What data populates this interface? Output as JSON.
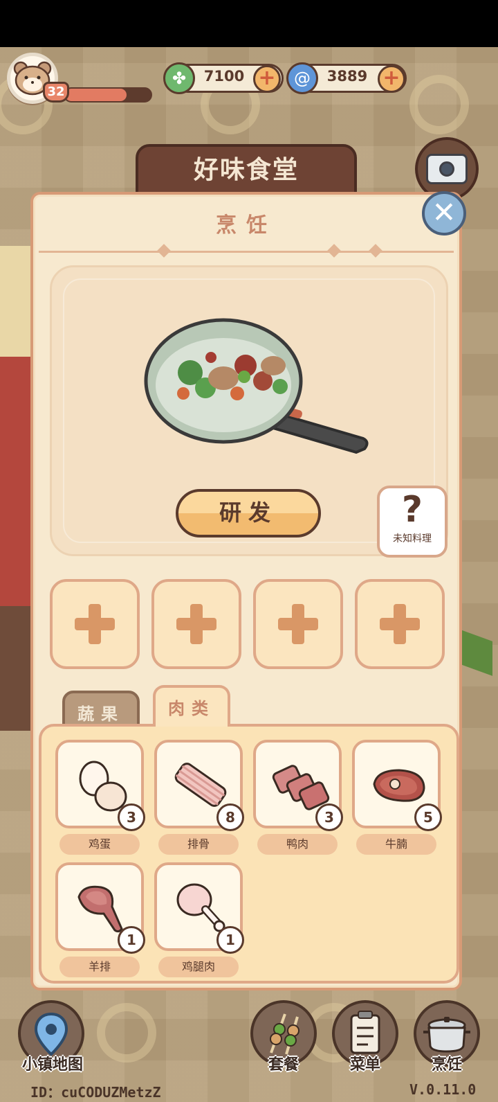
{
  "player": {
    "level": "32",
    "xp_progress": 0.72
  },
  "currencies": [
    {
      "name": "clover",
      "icon": "clover-icon",
      "value": "7100",
      "color": "#6fb86e"
    },
    {
      "name": "swirl",
      "icon": "swirl-icon",
      "value": "3889",
      "color": "#5e95d8"
    }
  ],
  "restaurant_sign": "好味食堂",
  "panel": {
    "title": "烹饪",
    "research_button": "研发",
    "unknown_dish": {
      "symbol": "?",
      "label": "未知料理"
    },
    "slot_count": 4
  },
  "tabs": [
    {
      "label": "蔬果",
      "active": false
    },
    {
      "label": "肉类",
      "active": true
    }
  ],
  "ingredients": [
    {
      "name": "鸡蛋",
      "count": "3",
      "icon": "egg-icon"
    },
    {
      "name": "排骨",
      "count": "8",
      "icon": "ribs-icon"
    },
    {
      "name": "鸭肉",
      "count": "3",
      "icon": "duck-meat-icon"
    },
    {
      "name": "牛腩",
      "count": "5",
      "icon": "beef-brisket-icon"
    },
    {
      "name": "羊排",
      "count": "1",
      "icon": "lamb-chop-icon"
    },
    {
      "name": "鸡腿肉",
      "count": "1",
      "icon": "chicken-leg-icon"
    }
  ],
  "bottom_nav": [
    {
      "label": "小镇地图",
      "icon": "map-pin-icon"
    },
    {
      "label": "套餐",
      "icon": "skewer-icon"
    },
    {
      "label": "菜单",
      "icon": "clipboard-icon"
    },
    {
      "label": "烹饪",
      "icon": "cooking-pot-icon"
    }
  ],
  "footer": {
    "id": "ID：cuCODUZMetzZ",
    "version": "V.0.11.0"
  },
  "colors": {
    "panel_bg": "#f7e9cf",
    "panel_border": "#d79a76",
    "accent_text": "#c8876a",
    "outline": "#5a3a2c"
  }
}
